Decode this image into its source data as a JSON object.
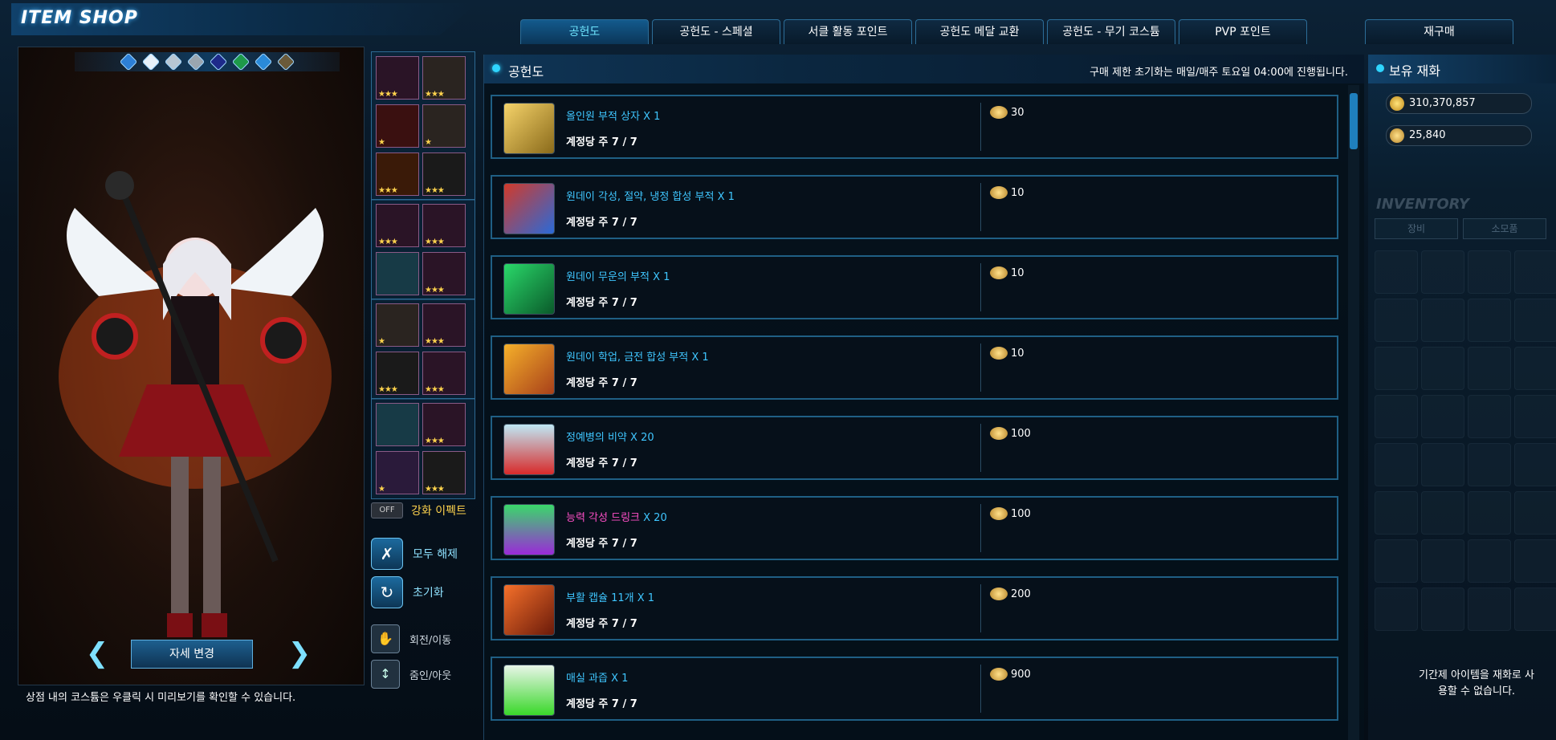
{
  "header": {
    "title": "ITEM SHOP"
  },
  "tabs": [
    {
      "label": "공헌도",
      "active": true
    },
    {
      "label": "공헌도 - 스페셜",
      "active": false
    },
    {
      "label": "서클 활동 포인트",
      "active": false
    },
    {
      "label": "공헌도 메달 교환",
      "active": false
    },
    {
      "label": "공헌도 - 무기 코스튬",
      "active": false
    },
    {
      "label": "PVP 포인트",
      "active": false
    }
  ],
  "rebuy_tab": "재구매",
  "section": {
    "title": "공헌도",
    "notice": "구매 제한 초기화는 매일/매주 토요일 04:00에 진행됩니다."
  },
  "items": [
    {
      "name": "올인원 부적 상자",
      "qty": "X 1",
      "limit": "계정당 주 7 / 7",
      "price": "30",
      "color": "blue"
    },
    {
      "name": "원데이 각성, 절약, 냉정 합성 부적",
      "qty": "X 1",
      "limit": "계정당 주 7 / 7",
      "price": "10",
      "color": "blue"
    },
    {
      "name": "원데이 무운의 부적",
      "qty": "X 1",
      "limit": "계정당 주 7 / 7",
      "price": "10",
      "color": "blue"
    },
    {
      "name": "원데이 학업, 금전 합성 부적",
      "qty": "X 1",
      "limit": "계정당 주 7 / 7",
      "price": "10",
      "color": "blue"
    },
    {
      "name": "정예병의 비약",
      "qty": "X 20",
      "limit": "계정당 주 7 / 7",
      "price": "100",
      "color": "blue"
    },
    {
      "name": "능력 각성 드링크",
      "qty": "X 20",
      "limit": "계정당 주 7 / 7",
      "price": "100",
      "color": "pink"
    },
    {
      "name": "부활 캡슐 11개",
      "qty": "X 1",
      "limit": "계정당 주 7 / 7",
      "price": "200",
      "color": "blue"
    },
    {
      "name": "매실 과즙",
      "qty": "X 1",
      "limit": "계정당 주 7 / 7",
      "price": "900",
      "color": "blue"
    }
  ],
  "currency": {
    "title": "보유 재화",
    "gold": "310,370,857",
    "medal": "25,840"
  },
  "inventory": {
    "title": "INVENTORY",
    "tabs": [
      "장비",
      "소모품"
    ]
  },
  "period_note": "기간제 아이템을 재화로 사용할 수 없습니다.",
  "preview": {
    "pose_button": "자세 변경",
    "bottom_note": "상점 내의 코스튬은 우클릭 시 미리보기를 확인할 수 있습니다.",
    "toggle_off": "OFF",
    "effect_label": "강화 이펙트",
    "unequip_all": "모두 해제",
    "reset": "초기화",
    "rotate_move": "회전/이동",
    "zoom": "줌인/아웃"
  },
  "colors": {
    "accent": "#3fc6ff",
    "pink_item": "#ff4fc8",
    "gold_text": "#ffd34d"
  }
}
